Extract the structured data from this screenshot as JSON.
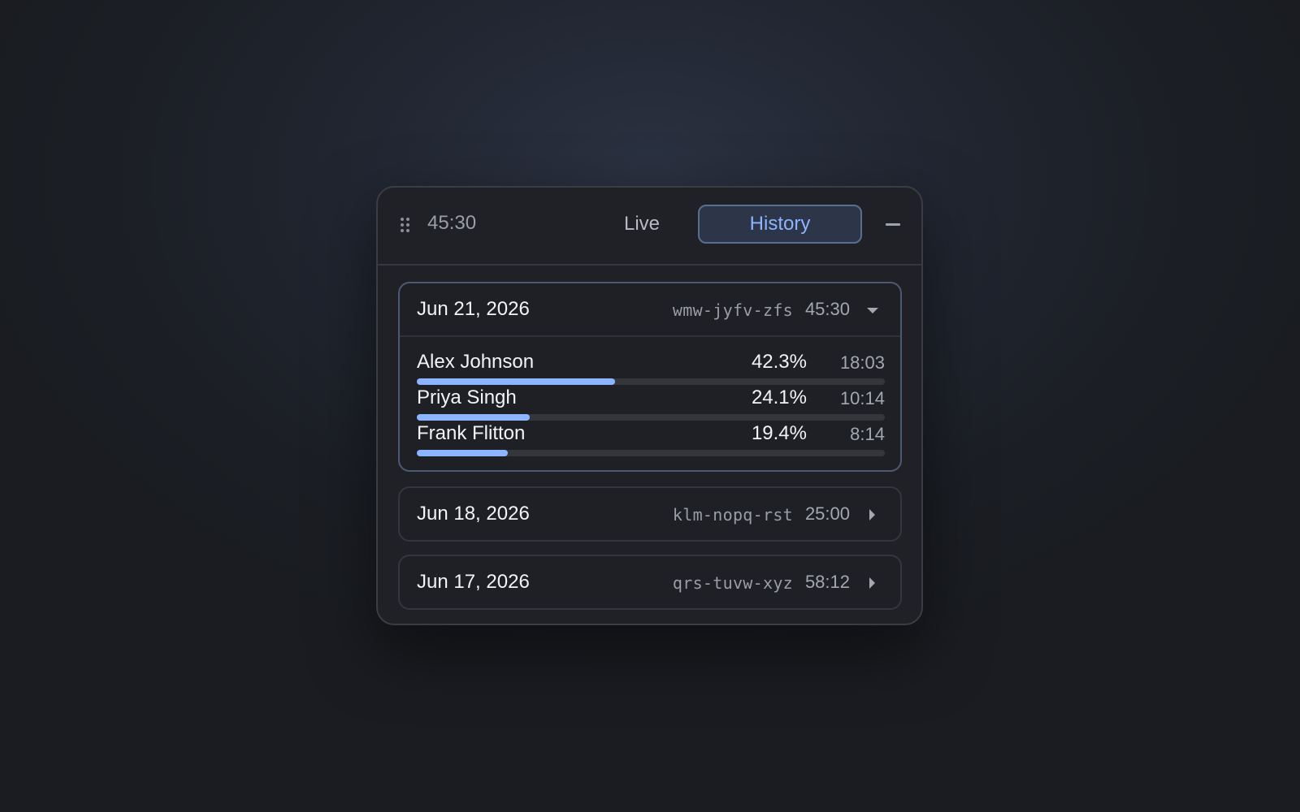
{
  "header": {
    "timer": "45:30",
    "tabs": {
      "live": "Live",
      "history": "History"
    },
    "active_tab": "History"
  },
  "sessions": [
    {
      "date": "Jun 21, 2026",
      "code": "wmw-jyfv-zfs",
      "duration": "45:30",
      "expanded": true,
      "participants": [
        {
          "name": "Alex Johnson",
          "percent": "42.3%",
          "time": "18:03",
          "share": 0.423
        },
        {
          "name": "Priya Singh",
          "percent": "24.1%",
          "time": "10:14",
          "share": 0.241
        },
        {
          "name": "Frank Flitton",
          "percent": "19.4%",
          "time": "8:14",
          "share": 0.194
        }
      ]
    },
    {
      "date": "Jun 18, 2026",
      "code": "klm-nopq-rst",
      "duration": "25:00",
      "expanded": false
    },
    {
      "date": "Jun 17, 2026",
      "code": "qrs-tuvw-xyz",
      "duration": "58:12",
      "expanded": false
    }
  ],
  "colors": {
    "accent": "#8cb4ff",
    "panel": "#1f2126",
    "track": "#34363c"
  },
  "icons": {
    "drag": "drag-handle-icon",
    "minimize": "minimize-icon",
    "expanded": "caret-down-icon",
    "collapsed": "caret-right-icon"
  }
}
